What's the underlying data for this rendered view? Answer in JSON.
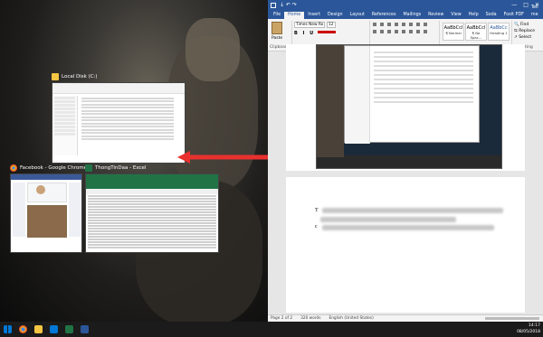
{
  "desktop": {
    "windows": [
      {
        "title": "Local Disk (C:)",
        "app": "file-explorer"
      },
      {
        "title": "Facebook - Google Chrome",
        "app": "chrome"
      },
      {
        "title": "ThongTinDaa - Excel",
        "app": "excel"
      }
    ]
  },
  "taskbar": {
    "time": "14:17",
    "date": "08/05/2018"
  },
  "word": {
    "quick_access": "↓  ↶  ↷",
    "tabs": [
      "File",
      "Home",
      "Insert",
      "Design",
      "Layout",
      "References",
      "Mailings",
      "Review",
      "View",
      "Help",
      "Soda",
      "Foxit PDF"
    ],
    "active_tab": "Home",
    "tell_me": "Tell me",
    "ribbon": {
      "paste": "Paste",
      "clipboard": "Clipboard",
      "font_name": "Times New Ro",
      "font_size": "12",
      "font": "Font",
      "paragraph": "Paragraph",
      "styles": "Styles",
      "editing": "Editing",
      "style_items": [
        {
          "sample": "AaBbCcI",
          "name": "¶ Normal"
        },
        {
          "sample": "AaBbCcI",
          "name": "¶ No Spac..."
        },
        {
          "sample": "AaBbCc",
          "name": "Heading 1"
        }
      ],
      "find": "Find",
      "replace": "Replace",
      "select": "Select"
    },
    "status": {
      "page": "Page 2 of 2",
      "words": "320 words",
      "language": "English (United States)"
    },
    "page2_first_char": "T",
    "page2_second_char": "c"
  },
  "colors": {
    "word_blue": "#2b579a",
    "arrow_red": "#e8312f",
    "excel_green": "#217346"
  }
}
